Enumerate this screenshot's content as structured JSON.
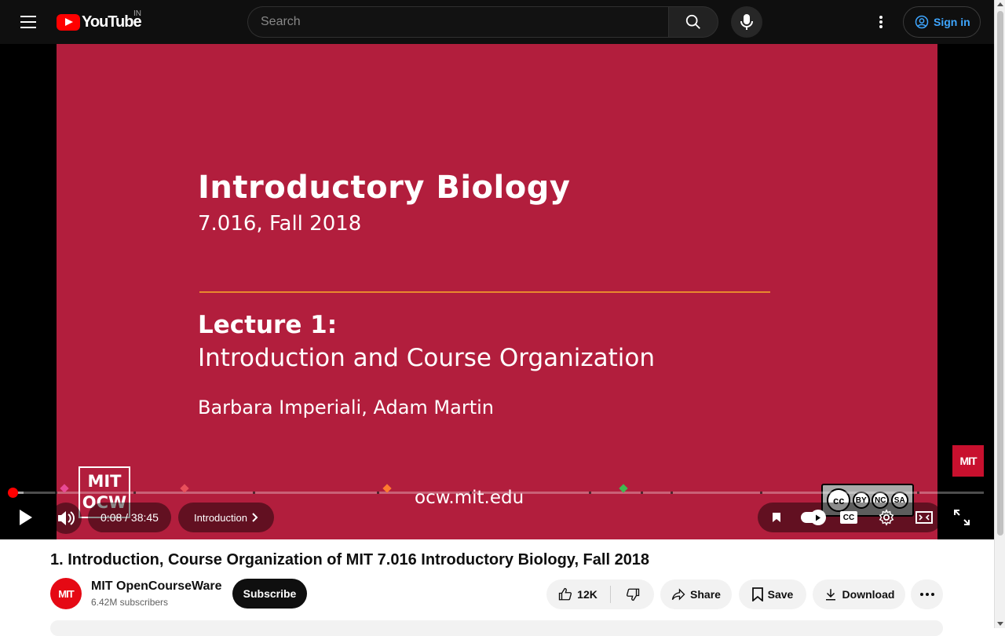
{
  "header": {
    "logo_text": "YouTube",
    "country_code": "IN",
    "search_placeholder": "Search",
    "sign_in_label": "Sign in"
  },
  "slide": {
    "title": "Introductory Biology",
    "subtitle": "7.016, Fall 2018",
    "lecture_label": "Lecture 1:",
    "lecture_title": "Introduction and Course Organization",
    "authors": "Barbara Imperiali, Adam Martin",
    "url": "ocw.mit.edu",
    "ocw_logo_line1": "MIT",
    "ocw_logo_line2": "OCW",
    "cc_badge_by": "BY",
    "cc_badge_nc": "NC",
    "cc_badge_sa": "SA",
    "corner_logo": "MIT"
  },
  "player": {
    "current_time": "0:08",
    "duration": "38:45",
    "time_display": "0:08 / 38:45",
    "chapter_label": "Introduction",
    "progress_fraction": 0.0034,
    "cc_label": "CC",
    "marker_colors": [
      "#e84a95",
      "#e8505b",
      "#ff7a2f",
      "#3fb950"
    ]
  },
  "video": {
    "title": "1. Introduction, Course Organization of MIT 7.016 Introductory Biology, Fall 2018",
    "channel_name": "MIT OpenCourseWare",
    "channel_avatar": "MIT",
    "subscribers": "6.42M subscribers",
    "subscribe_label": "Subscribe",
    "like_count": "12K",
    "share_label": "Share",
    "save_label": "Save",
    "download_label": "Download"
  },
  "colors": {
    "slide_bg": "#b21e3d",
    "accent_red": "#ff0000",
    "link_blue": "#3ea6ff"
  }
}
